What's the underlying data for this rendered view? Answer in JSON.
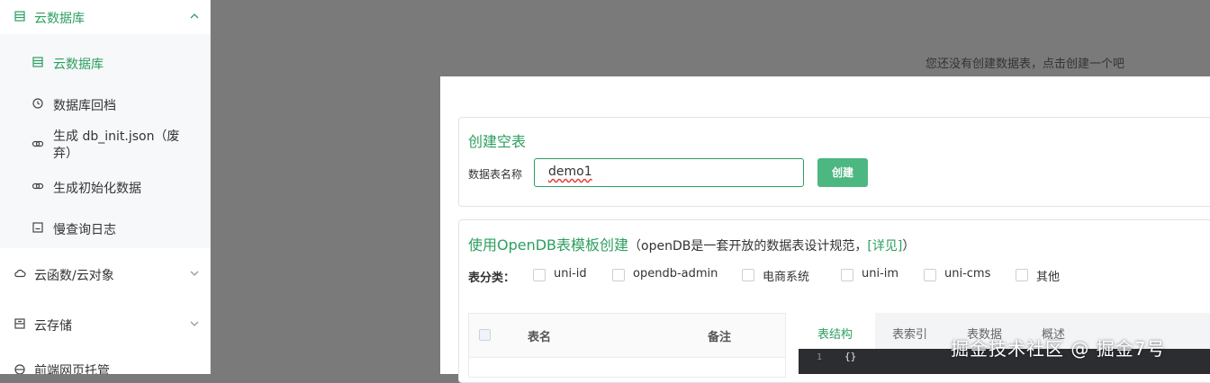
{
  "sidebar": {
    "database": {
      "label": "云数据库",
      "icon": "database-icon"
    },
    "sub_items": [
      {
        "label": "云数据库",
        "icon": "database-icon",
        "active": true
      },
      {
        "label": "数据库回档",
        "icon": "clock-icon"
      },
      {
        "label": "生成 db_init.json（废弃）",
        "icon": "link-icon"
      },
      {
        "label": "生成初始化数据",
        "icon": "link-icon"
      },
      {
        "label": "慢查询日志",
        "icon": "log-icon"
      }
    ],
    "functions": {
      "label": "云函数/云对象",
      "icon": "cloud-icon"
    },
    "storage": {
      "label": "云存储",
      "icon": "storage-icon"
    },
    "hosting": {
      "label": "前端网页托管",
      "icon": "globe-icon"
    }
  },
  "empty_hint": "您还没有创建数据表，点击创建一个吧",
  "create_table": {
    "title": "创建空表",
    "name_label": "数据表名称",
    "name_value": "demo1",
    "create_button": "创建"
  },
  "opendb": {
    "title": "使用OpenDB表模板创建",
    "desc_prefix": "（openDB是一套开放的数据表设计规范，",
    "desc_link": "[详见]",
    "desc_suffix": "）",
    "category_label": "表分类：",
    "categories": [
      "uni-id",
      "opendb-admin",
      "电商系统",
      "uni-im",
      "uni-cms",
      "其他"
    ],
    "table_headers": {
      "name": "表名",
      "note": "备注"
    },
    "tabs": [
      "表结构",
      "表索引",
      "表数据",
      "概述"
    ],
    "code_line_number": "1",
    "code_content": "{}"
  },
  "watermark": "掘金技术社区 @ 掘金7号",
  "colors": {
    "accent": "#2c9f5f",
    "button": "#4cb781"
  }
}
